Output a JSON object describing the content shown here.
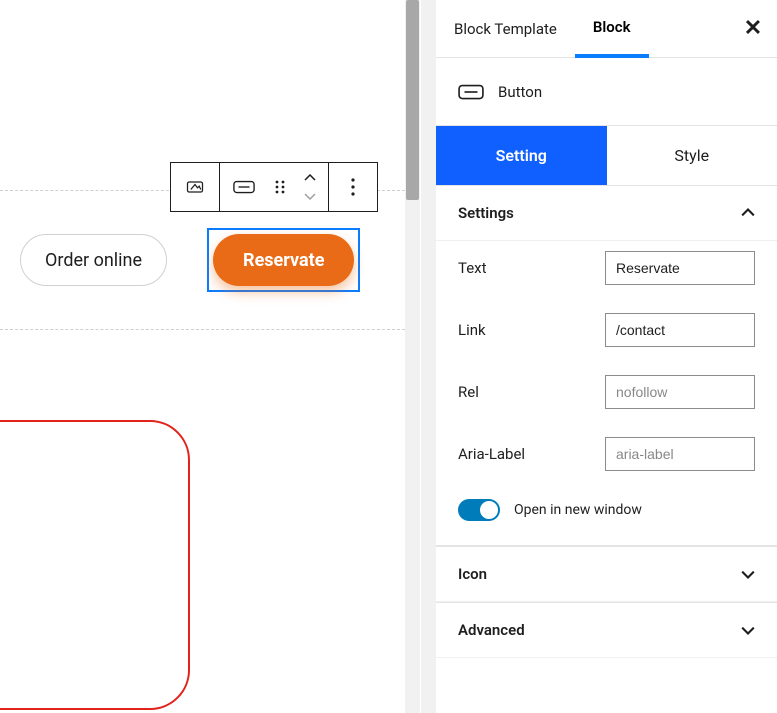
{
  "sidebar": {
    "tabs": {
      "template_label": "Block Template",
      "block_label": "Block"
    },
    "block_type_name": "Button",
    "subtabs": {
      "setting": "Setting",
      "style": "Style"
    },
    "sections": {
      "settings": "Settings",
      "icon": "Icon",
      "advanced": "Advanced"
    },
    "fields": {
      "text": {
        "label": "Text",
        "value": "Reservate"
      },
      "link": {
        "label": "Link",
        "value": "/contact"
      },
      "rel": {
        "label": "Rel",
        "placeholder": "nofollow",
        "value": ""
      },
      "aria": {
        "label": "Aria-Label",
        "placeholder": "aria-label",
        "value": ""
      },
      "new_window": {
        "label": "Open in new window",
        "on": true
      }
    }
  },
  "canvas": {
    "buttons": {
      "order_online": "Order online",
      "reservate": "Reservate"
    }
  },
  "colors": {
    "accent": "#0f62fe",
    "button_bg": "#e96b17",
    "selection": "#0a7cff"
  }
}
